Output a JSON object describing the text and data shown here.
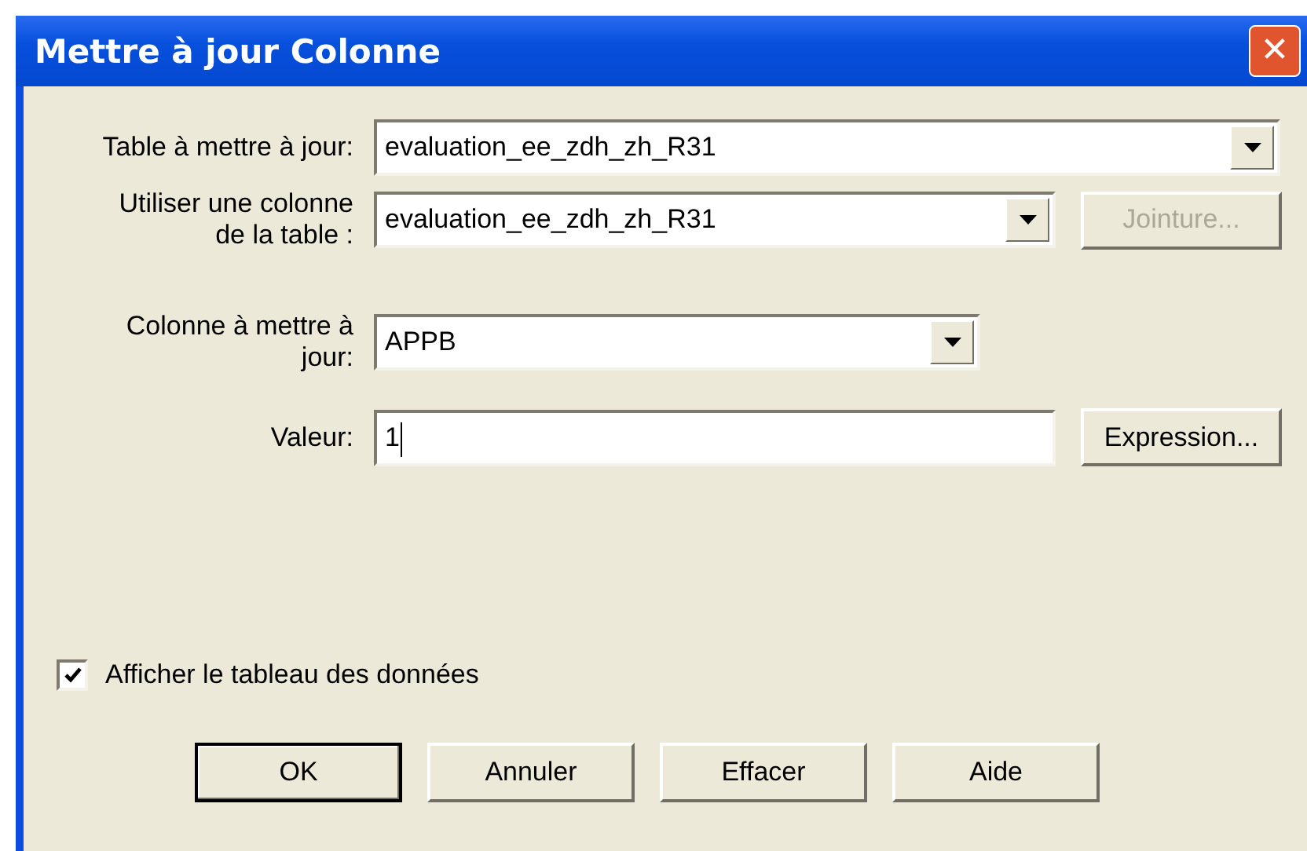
{
  "window": {
    "title": "Mettre à jour Colonne",
    "close": "✕"
  },
  "rows": [
    {
      "kind": "combo",
      "label": "Table à mettre à jour:",
      "value": "evaluation_ee_zdh_zh_R31"
    },
    {
      "kind": "combo",
      "label": "Utiliser une colonne de la table :",
      "value": "evaluation_ee_zdh_zh_R31",
      "button": {
        "label": "Jointure...",
        "disabled": true
      }
    },
    {
      "kind": "combo",
      "label": "Colonne à mettre à jour:",
      "value": "APPB"
    },
    {
      "kind": "text",
      "label": "Valeur:",
      "value": "1",
      "button": {
        "label": "Expression...",
        "disabled": false
      }
    }
  ],
  "checkbox": {
    "label": "Afficher le tableau des données",
    "checked": true
  },
  "buttons": [
    {
      "label": "OK",
      "default": true
    },
    {
      "label": "Annuler",
      "default": false
    },
    {
      "label": "Effacer",
      "default": false
    },
    {
      "label": "Aide",
      "default": false
    }
  ]
}
